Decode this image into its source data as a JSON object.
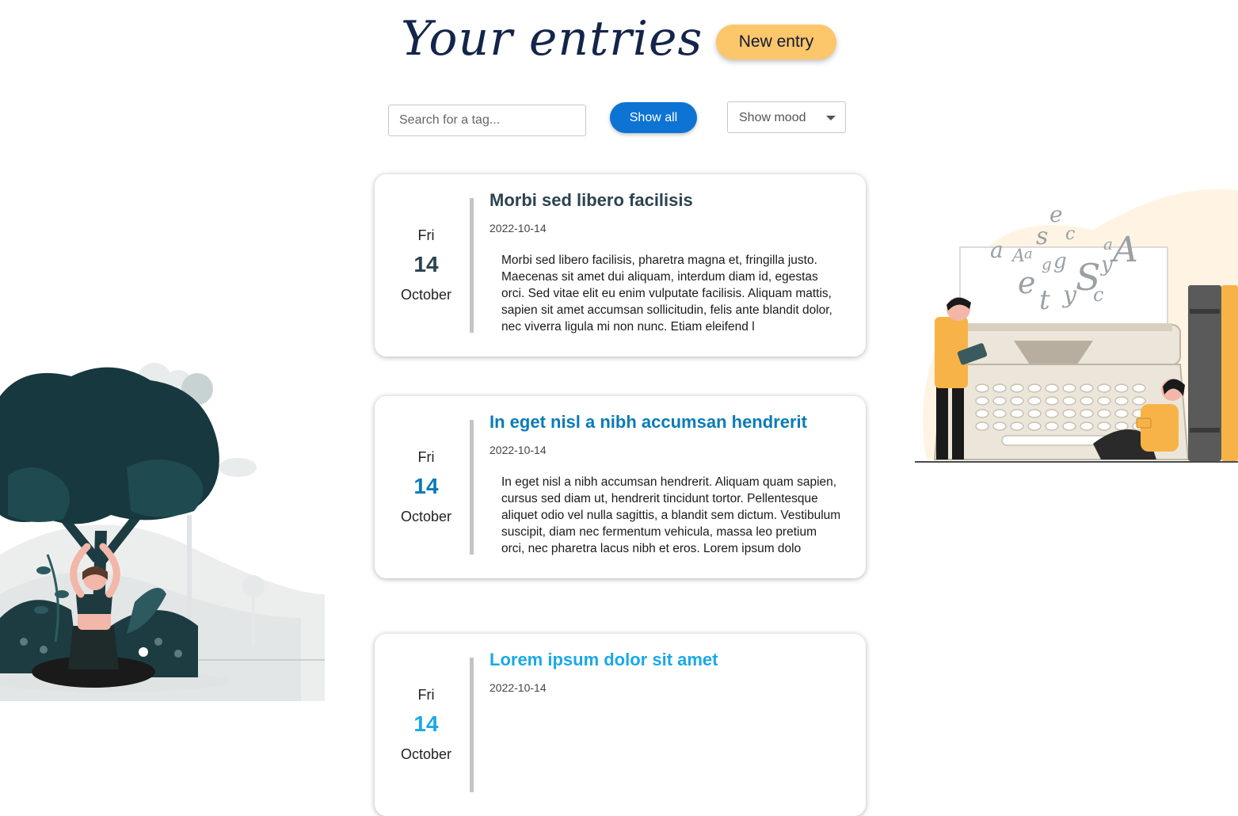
{
  "header": {
    "title": "Your entries",
    "new_entry_label": "New entry"
  },
  "filters": {
    "search_placeholder": "Search for a tag...",
    "show_all_label": "Show all",
    "mood_label": "Show mood"
  },
  "entries": [
    {
      "day_name": "Fri",
      "day_num": "14",
      "month": "October",
      "title": "Morbi sed libero facilisis",
      "date": "2022-10-14",
      "body": "Morbi sed libero facilisis, pharetra magna et, fringilla justo. Maecenas sit amet dui aliquam, interdum diam id, egestas orci. Sed vitae elit eu enim vulputate facilisis. Aliquam mattis, sapien sit amet accumsan sollicitudin, felis ante blandit dolor, nec viverra ligula mi non nunc. Etiam eleifend l",
      "accent_color": "#2c4350"
    },
    {
      "day_name": "Fri",
      "day_num": "14",
      "month": "October",
      "title": "In eget nisl a nibh accumsan hendrerit",
      "date": "2022-10-14",
      "body": "In eget nisl a nibh accumsan hendrerit. Aliquam quam sapien, cursus sed diam ut, hendrerit tincidunt tortor. Pellentesque aliquet odio vel nulla sagittis, a blandit sem dictum. Vestibulum suscipit, diam nec fermentum vehicula, massa leo pretium orci, nec pharetra lacus nibh et eros. Lorem ipsum dolo",
      "accent_color": "#0a7bb8"
    },
    {
      "day_name": "Fri",
      "day_num": "14",
      "month": "October",
      "title": "Lorem ipsum dolor sit amet",
      "date": "2022-10-14",
      "body": "",
      "accent_color": "#1aa9e6"
    }
  ],
  "colors": {
    "title": "#14254a",
    "new_entry_bg": "#fcc66a",
    "show_all_bg": "#0d74d4"
  },
  "illustrations": {
    "left": "meditation-illustration",
    "right": "typewriter-reading-illustration"
  }
}
